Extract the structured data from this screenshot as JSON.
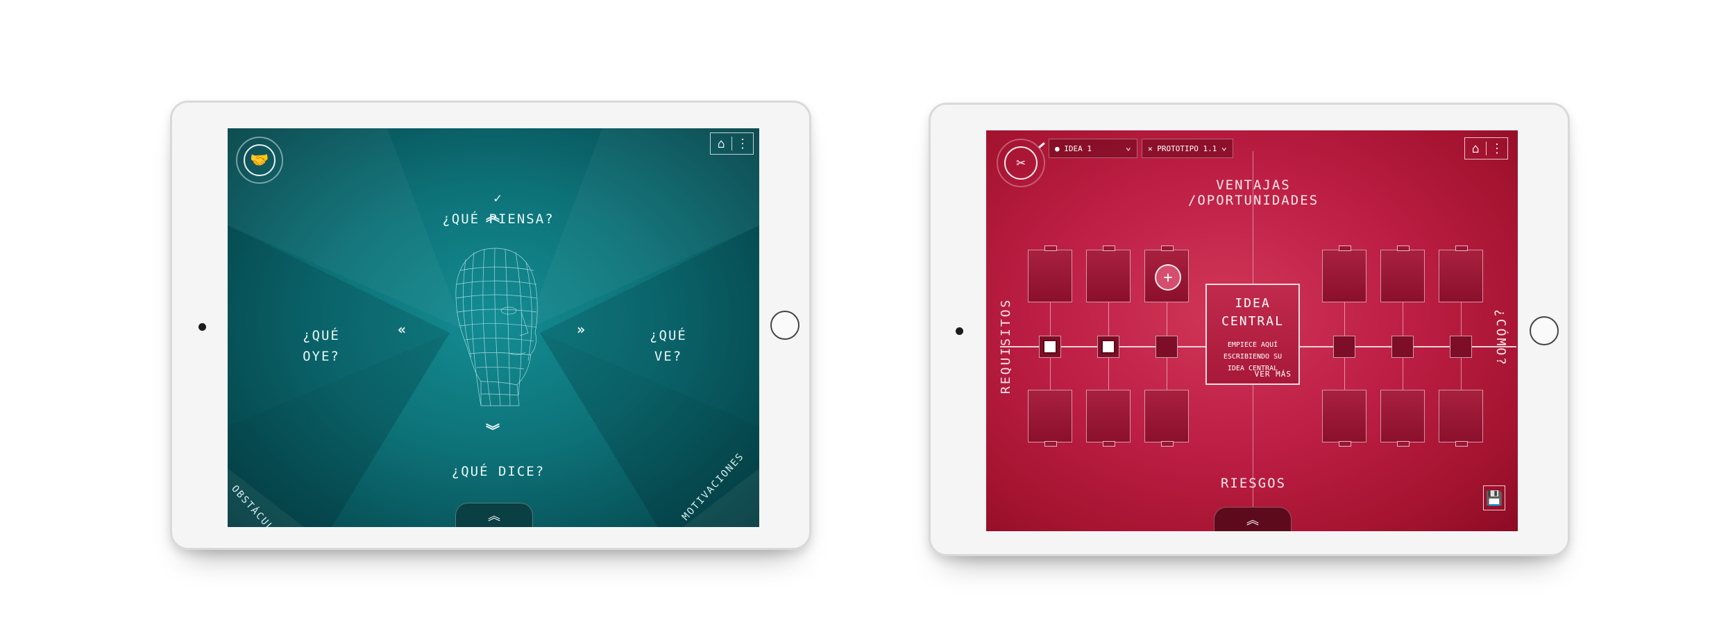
{
  "left_app": {
    "top_icons": {
      "home": "home-icon",
      "menu": "menu-icon"
    },
    "hub_icon": "handshake-icon",
    "labels": {
      "top_check": "✓",
      "top": "¿QUÉ PIENSA?",
      "left": "¿QUÉ\nOYE?",
      "right": "¿QUÉ\nVE?",
      "bottom": "¿QUÉ DICE?"
    },
    "corners": {
      "bottom_left": "OBSTÁCULOS",
      "bottom_right": "MOTIVACIONES"
    },
    "colors": {
      "background": "#0d7278",
      "accent": "#eaf7f7"
    }
  },
  "right_app": {
    "top_icons": {
      "home": "home-icon",
      "menu": "menu-icon"
    },
    "hub_icon": "tools-icon",
    "dropdowns": [
      {
        "icon": "bulb-icon",
        "value": "IDEA 1"
      },
      {
        "icon": "tools-icon",
        "value": "PROTOTIPO 1.1"
      }
    ],
    "labels": {
      "top": "VENTAJAS /OPORTUNIDADES",
      "bottom": "RIESGOS",
      "left": "REQUISITOS",
      "right": "¿CÓMO?"
    },
    "central": {
      "title": "IDEA\nCENTRAL",
      "body": "EMPIECE AQUÍ\nESCRIBIENDO SU\nIDEA CENTRAL",
      "link": "VER MÁS"
    },
    "save_icon": "save-icon",
    "colors": {
      "background": "#bd1e44",
      "accent": "#fde8ec"
    }
  }
}
